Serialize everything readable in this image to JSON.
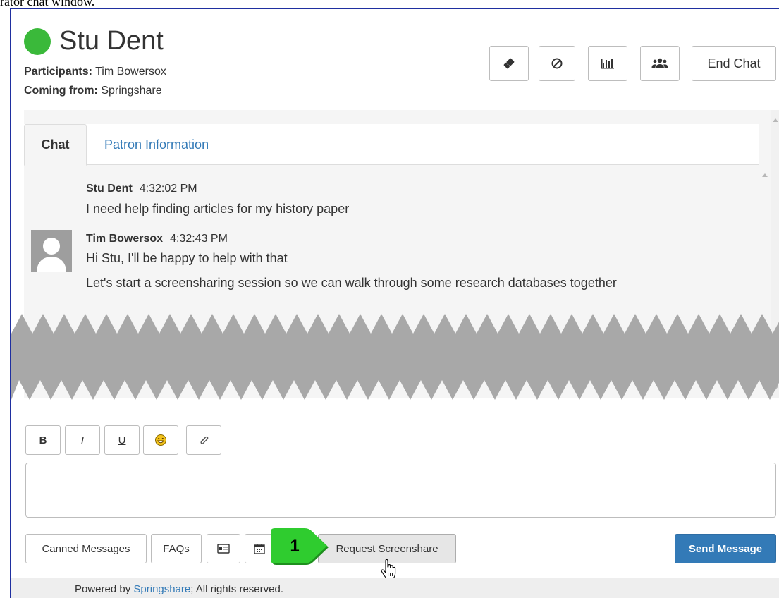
{
  "caption": "rator chat window.",
  "header": {
    "patron_name": "Stu Dent",
    "status_color": "#3ab93a",
    "participants_label": "Participants:",
    "participants_value": "Tim Bowersox",
    "coming_from_label": "Coming from:",
    "coming_from_value": "Springshare",
    "toolbar": {
      "transfer_icon": "ticket-icon",
      "block_icon": "ban-icon",
      "stats_icon": "bar-chart-icon",
      "participants_icon": "users-icon",
      "end_chat_label": "End Chat"
    }
  },
  "tabs": [
    {
      "label": "Chat",
      "active": true
    },
    {
      "label": "Patron Information",
      "active": false
    }
  ],
  "messages": [
    {
      "sender": "Stu Dent",
      "time": "4:32:02 PM",
      "lines": [
        "I need help finding articles for my history paper"
      ]
    },
    {
      "sender": "Tim Bowersox",
      "time": "4:32:43 PM",
      "lines": [
        "Hi Stu, I'll be happy to help with that",
        "Let's start a screensharing session so we can walk through some research databases together"
      ]
    }
  ],
  "format_toolbar": {
    "bold": "B",
    "italic": "I",
    "underline": "U",
    "emoji_icon": "smiley-icon",
    "attach_icon": "paperclip-icon"
  },
  "compose": {
    "value": "",
    "placeholder": ""
  },
  "actions": {
    "canned_messages": "Canned Messages",
    "faqs": "FAQs",
    "card_icon": "id-card-icon",
    "calendar_icon": "calendar-icon",
    "request_screenshare": "Request Screenshare",
    "send_message": "Send Message"
  },
  "annotation": {
    "number": "1",
    "color": "#2fcc2f"
  },
  "footer": {
    "prefix": "Powered by ",
    "link": "Springshare",
    "suffix": "; All rights reserved."
  }
}
